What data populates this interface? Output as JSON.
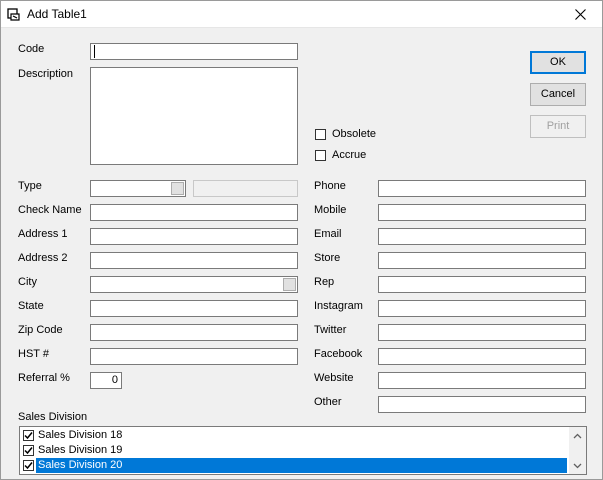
{
  "window": {
    "title": "Add Table1"
  },
  "buttons": {
    "ok": "OK",
    "cancel": "Cancel",
    "print": "Print"
  },
  "checkboxes": {
    "obsolete": "Obsolete",
    "accrue": "Accrue"
  },
  "left_labels": {
    "code": "Code",
    "description": "Description",
    "type": "Type",
    "check_name": "Check Name",
    "address1": "Address 1",
    "address2": "Address 2",
    "city": "City",
    "state": "State",
    "zip": "Zip Code",
    "hst": "HST #",
    "referral": "Referral %"
  },
  "referral_value": "0",
  "right_labels": {
    "phone": "Phone",
    "mobile": "Mobile",
    "email": "Email",
    "store": "Store",
    "rep": "Rep",
    "instagram": "Instagram",
    "twitter": "Twitter",
    "facebook": "Facebook",
    "website": "Website",
    "other": "Other"
  },
  "sales_division": {
    "label": "Sales Division",
    "items": [
      {
        "label": "Sales Division 18",
        "checked": true,
        "selected": false
      },
      {
        "label": "Sales Division 19",
        "checked": true,
        "selected": false
      },
      {
        "label": "Sales Division 20",
        "checked": true,
        "selected": true
      }
    ]
  },
  "colors": {
    "selection": "#0078d7",
    "background": "#f0f0f0"
  }
}
